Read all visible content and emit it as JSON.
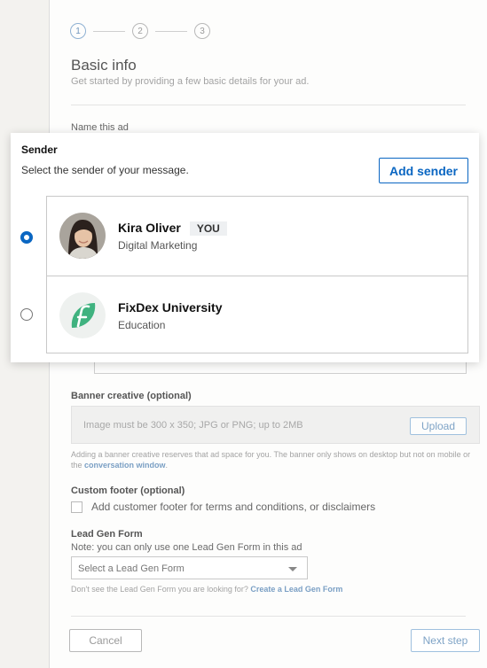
{
  "stepper": {
    "steps": [
      "1",
      "2",
      "3"
    ]
  },
  "basic_info": {
    "title": "Basic info",
    "subtitle": "Get started by providing a few basic details for your ad.",
    "name_label": "Name this ad"
  },
  "sender_panel": {
    "title": "Sender",
    "description": "Select the sender of your message.",
    "add_sender_label": "Add sender",
    "senders": [
      {
        "name": "Kira Oliver",
        "badge": "YOU",
        "subtitle": "Digital Marketing",
        "selected": true
      },
      {
        "name": "FixDex University",
        "badge": "",
        "subtitle": "Education",
        "selected": false
      }
    ]
  },
  "banner": {
    "label": "Banner creative (optional)",
    "placeholder": "Image must be 300 x 350; JPG or PNG; up to 2MB",
    "upload_label": "Upload",
    "help_text": "Adding a banner creative reserves that ad space for you. The banner only shows on desktop but not on mobile or the",
    "help_link": "conversation window",
    "help_end": "."
  },
  "footer": {
    "label": "Custom footer (optional)",
    "checkbox_text": "Add customer footer for terms and conditions, or disclaimers"
  },
  "lead_gen": {
    "label": "Lead Gen Form",
    "note": "Note: you can only use one Lead Gen Form in this ad",
    "select_value": "Select a Lead Gen Form",
    "help_text": "Don't see the Lead Gen Form you are looking for?",
    "help_link": "Create a Lead Gen Form"
  },
  "actions": {
    "cancel_label": "Cancel",
    "next_label": "Next step"
  },
  "colors": {
    "accent": "#0a66c2",
    "fixdex_green": "#3fb27f"
  }
}
